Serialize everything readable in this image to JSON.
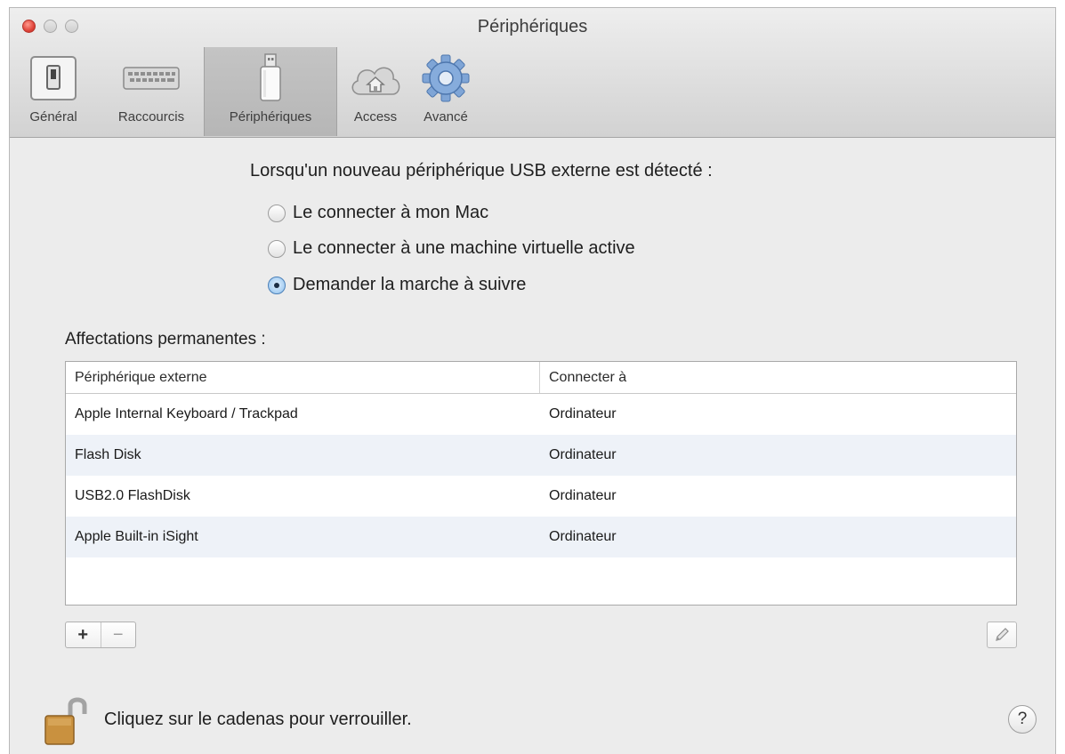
{
  "window": {
    "title": "Périphériques"
  },
  "toolbar": {
    "items": [
      {
        "label": "Général",
        "icon": "general-switch-icon"
      },
      {
        "label": "Raccourcis",
        "icon": "keyboard-icon"
      },
      {
        "label": "Périphériques",
        "icon": "usb-device-icon",
        "selected": true
      },
      {
        "label": "Access",
        "icon": "cloud-home-icon"
      },
      {
        "label": "Avancé",
        "icon": "gear-icon"
      }
    ]
  },
  "usb": {
    "prompt": "Lorsqu'un nouveau périphérique USB externe est détecté :",
    "options": [
      {
        "label": "Le connecter à mon Mac",
        "selected": false
      },
      {
        "label": "Le connecter à une machine virtuelle active",
        "selected": false
      },
      {
        "label": "Demander la marche à suivre",
        "selected": true
      }
    ]
  },
  "assignments": {
    "label": "Affectations permanentes :",
    "columns": [
      "Périphérique externe",
      "Connecter à"
    ],
    "rows": [
      {
        "device": "Apple Internal Keyboard / Trackpad",
        "target": "Ordinateur"
      },
      {
        "device": "Flash Disk",
        "target": "Ordinateur"
      },
      {
        "device": "USB2.0 FlashDisk",
        "target": "Ordinateur"
      },
      {
        "device": "Apple Built-in iSight",
        "target": "Ordinateur"
      }
    ],
    "add_label": "+",
    "remove_label": "−"
  },
  "footer": {
    "lock_text": "Cliquez sur le cadenas pour verrouiller.",
    "help_label": "?"
  },
  "colors": {
    "window_bg": "#ececec",
    "row_alt": "#eef2f8",
    "close_red": "#e0443a",
    "radio_selected": "#8fc0ec"
  }
}
